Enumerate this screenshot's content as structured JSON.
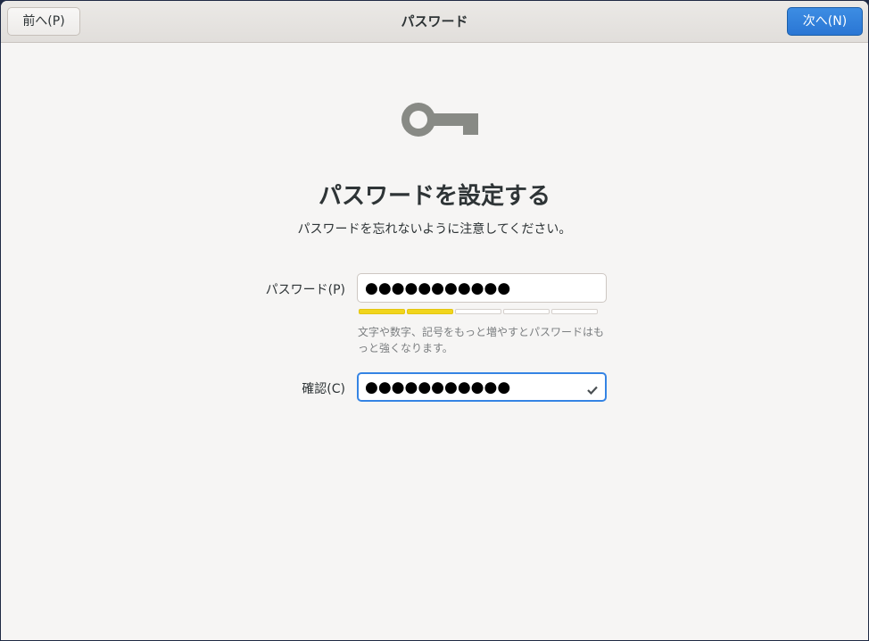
{
  "header": {
    "title": "パスワード",
    "back_label": "前へ(P)",
    "next_label": "次へ(N)"
  },
  "main": {
    "icon": "key-icon",
    "title": "パスワードを設定する",
    "subtitle": "パスワードを忘れないように注意してください。",
    "password_label": "パスワード(P)",
    "password_value": "●●●●●●●●●●●",
    "strength_level": 0.4,
    "strength_segments_total": 5,
    "strength_segments_filled": 2,
    "hint": "文字や数字、記号をもっと増やすとパスワードはもっと強くなります。",
    "confirm_label": "確認(C)",
    "confirm_value": "●●●●●●●●●●●",
    "confirm_status_icon": "checkmark-icon"
  },
  "colors": {
    "accent": "#3584e4",
    "strength_fill": "#f1d51c",
    "background": "#f6f5f4"
  }
}
